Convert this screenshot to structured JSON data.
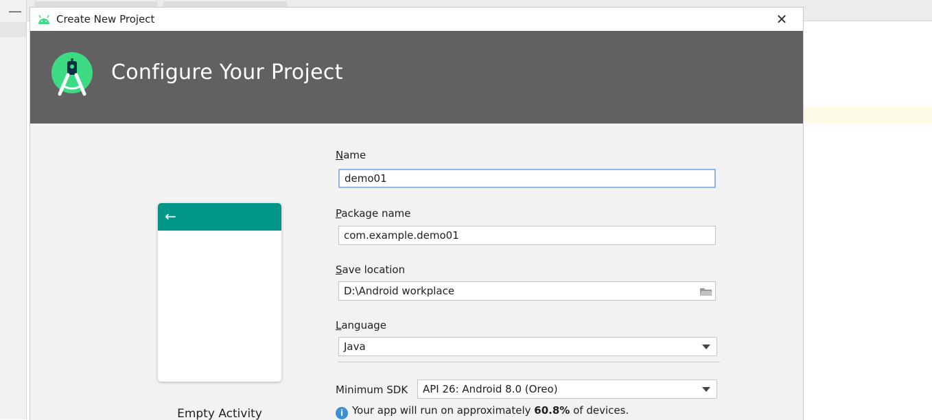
{
  "dialog": {
    "title": "Create New Project",
    "close_glyph": "✕",
    "banner_title": "Configure Your Project"
  },
  "preview": {
    "back_glyph": "←",
    "template_name": "Empty Activity"
  },
  "form": {
    "name": {
      "mnemonic": "N",
      "label_rest": "ame",
      "value": "demo01"
    },
    "package": {
      "mnemonic": "P",
      "label_rest": "ackage name",
      "value": "com.example.demo01"
    },
    "save_location": {
      "mnemonic": "S",
      "label_rest": "ave location",
      "value": "D:\\Android workplace"
    },
    "language": {
      "mnemonic": "L",
      "label_rest": "anguage",
      "value": "Java"
    },
    "min_sdk": {
      "label": "Minimum SDK",
      "value": "API 26: Android 8.0 (Oreo)"
    },
    "info": {
      "prefix": "Your app will run on approximately ",
      "percent": "60.8%",
      "suffix": " of devices."
    }
  },
  "colors": {
    "banner": "#616161",
    "android_green": "#3ddc84",
    "preview_toolbar": "#009688",
    "focus_border": "#8fb7e6",
    "info_blue": "#3c8fd7"
  },
  "icons": [
    "android-icon",
    "close-icon",
    "android-studio-logo-icon",
    "back-arrow-icon",
    "folder-icon",
    "chevron-down-icon",
    "info-icon"
  ]
}
